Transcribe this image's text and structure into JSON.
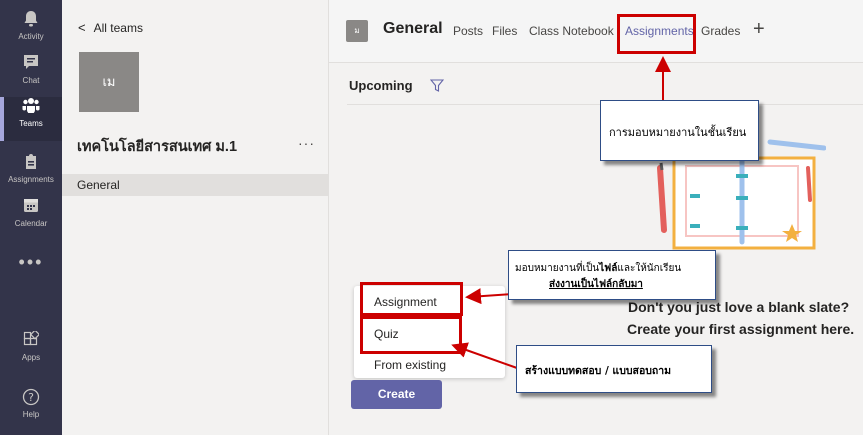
{
  "rail": {
    "items": [
      {
        "label": "Activity",
        "icon": "bell-icon"
      },
      {
        "label": "Chat",
        "icon": "chat-icon"
      },
      {
        "label": "Teams",
        "icon": "teams-icon"
      },
      {
        "label": "Assignments",
        "icon": "assignments-icon"
      },
      {
        "label": "Calendar",
        "icon": "calendar-icon"
      },
      {
        "label": "Apps",
        "icon": "apps-icon"
      },
      {
        "label": "Help",
        "icon": "help-icon"
      }
    ],
    "more_label": "•••",
    "active_index": 2
  },
  "side": {
    "back_label": "All teams",
    "team_tile": "เม",
    "team_name": "เทคโนโลยีสารสนเทศ ม.1",
    "more_label": "···",
    "channel": "General"
  },
  "header": {
    "channel_icon": "ม",
    "channel_name": "General",
    "tabs": [
      "Posts",
      "Files",
      "Class Notebook",
      "Assignments",
      "Grades"
    ],
    "active_tab": "Assignments",
    "add_tab": "+"
  },
  "main": {
    "section": "Upcoming",
    "empty_line1": "Don't you just love a blank slate?",
    "empty_line2": "Create your first assignment here.",
    "menu": [
      "Assignment",
      "Quiz",
      "From existing"
    ],
    "create_label": "Create"
  },
  "annotations": {
    "tab_note": "การมอบหมายงานในชั้นเรียน",
    "assign_note_1": "มอบหมายงานที่เป็น",
    "assign_note_bold": "ไฟล์",
    "assign_note_2": "และให้นักเรียน",
    "assign_note_line2": "ส่งงานเป็นไฟล์กลับมา",
    "quiz_note": "สร้างแบบทดสอบ / แบบสอบถาม"
  },
  "colors": {
    "rail_bg": "#33344a",
    "accent": "#6264a7",
    "annotation_red": "#cc0000"
  }
}
